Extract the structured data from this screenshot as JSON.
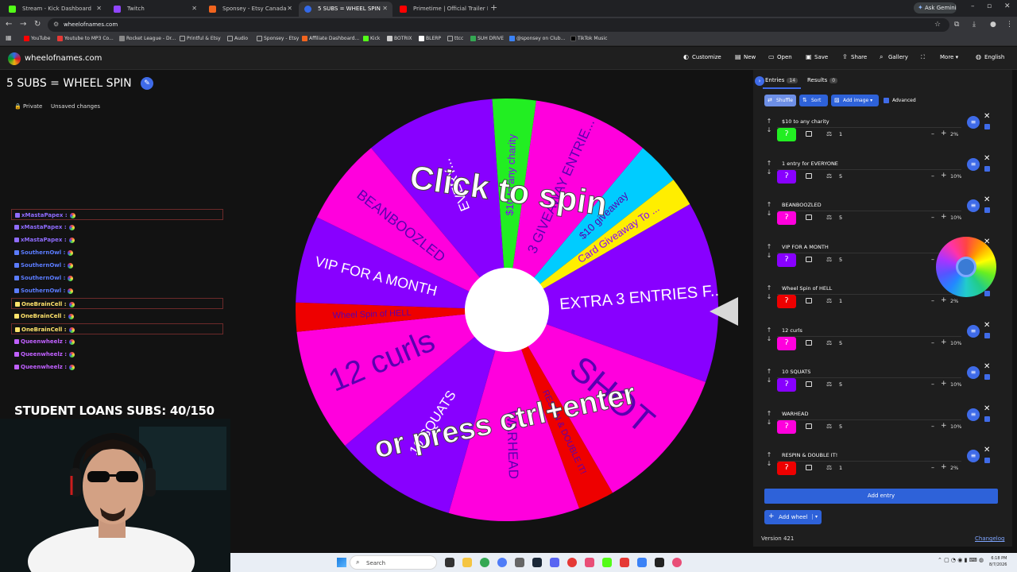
{
  "browser": {
    "tabs": [
      {
        "title": "Stream - Kick Dashboard",
        "color": "#53fc18"
      },
      {
        "title": "Twitch",
        "color": "#9146ff"
      },
      {
        "title": "Sponsey - Etsy Canada",
        "color": "#f1641e"
      },
      {
        "title": "5 SUBS = WHEEL SPIN",
        "color": "#3369e8"
      },
      {
        "title": "Primetime | Official Trailer HD |",
        "color": "#ff0000"
      }
    ],
    "gemini_label": "Ask Gemini",
    "url": "wheelofnames.com",
    "bookmarks": [
      {
        "label": "YouTube",
        "color": "#ff0000"
      },
      {
        "label": "Youtube to MP3 Co...",
        "color": "#e53935"
      },
      {
        "label": "Rocket League - Dr...",
        "color": "#888888"
      },
      {
        "label": "Printful & Etsy",
        "color": "#8a8a8a"
      },
      {
        "label": "Audio",
        "color": "#8a8a8a"
      },
      {
        "label": "Sponsey - Etsy",
        "color": "#8a8a8a"
      },
      {
        "label": "Affiliate Dashboard...",
        "color": "#f1641e"
      },
      {
        "label": "Kick",
        "color": "#53fc18"
      },
      {
        "label": "BOTRIX",
        "color": "#cccccc"
      },
      {
        "label": "BLERP",
        "color": "#ffffff"
      },
      {
        "label": "ttcc",
        "color": "#8a8a8a"
      },
      {
        "label": "SUH DRIVE",
        "color": "#34a853"
      },
      {
        "label": "@sponsey on Club...",
        "color": "#3b82f6"
      },
      {
        "label": "TikTok Music",
        "color": "#000000"
      }
    ]
  },
  "site": {
    "name": "wheelofnames.com",
    "nav": [
      {
        "label": "Customize",
        "icon": "palette-icon"
      },
      {
        "label": "New",
        "icon": "new-file-icon"
      },
      {
        "label": "Open",
        "icon": "folder-icon"
      },
      {
        "label": "Save",
        "icon": "save-icon"
      },
      {
        "label": "Share",
        "icon": "share-icon"
      },
      {
        "label": "Gallery",
        "icon": "search-icon"
      },
      {
        "label": "",
        "icon": "fullscreen-icon"
      },
      {
        "label": "More",
        "icon": "chevron-down-icon"
      },
      {
        "label": "English",
        "icon": "globe-icon"
      }
    ]
  },
  "page": {
    "title": "5 SUBS = WHEEL SPIN",
    "private_label": "Private",
    "unsaved_label": "Unsaved changes"
  },
  "chat": [
    {
      "user": "xMastaPapex :",
      "color": "#8f6cff",
      "boxed": true
    },
    {
      "user": "xMastaPapex :",
      "color": "#8f6cff",
      "boxed": false
    },
    {
      "user": "xMastaPapex :",
      "color": "#8f6cff",
      "boxed": false
    },
    {
      "user": "SouthernOwl :",
      "color": "#5b7cff",
      "boxed": false
    },
    {
      "user": "SouthernOwl :",
      "color": "#5b7cff",
      "boxed": false
    },
    {
      "user": "SouthernOwl :",
      "color": "#5b7cff",
      "boxed": false
    },
    {
      "user": "SouthernOwl :",
      "color": "#5b7cff",
      "boxed": false
    },
    {
      "user": "OneBrainCell :",
      "color": "#ffe36b",
      "boxed": true
    },
    {
      "user": "OneBrainCell :",
      "color": "#ffe36b",
      "boxed": false
    },
    {
      "user": "OneBrainCell :",
      "color": "#ffe36b",
      "boxed": true
    },
    {
      "user": "Queenwheelz :",
      "color": "#c060ff",
      "boxed": false
    },
    {
      "user": "Queenwheelz :",
      "color": "#c060ff",
      "boxed": false
    },
    {
      "user": "Queenwheelz :",
      "color": "#c060ff",
      "boxed": false
    }
  ],
  "overlay": {
    "subgoal": "STUDENT LOANS SUBS: 40/150"
  },
  "wheel": {
    "click_text": "Click to spin",
    "press_text": "or press ctrl+enter",
    "slices": [
      {
        "label": "EVERY...",
        "color": "#8800ff"
      },
      {
        "label": "$10 to any charity",
        "color": "#22ee22"
      },
      {
        "label": "3 GIVEAWAY ENTRIE...",
        "color": "#ff00dd"
      },
      {
        "label": "$10 giveaway",
        "color": "#00ccff"
      },
      {
        "label": "Card Giveaway To ...",
        "color": "#ffee00"
      },
      {
        "label": "EXTRA 3 ENTRIES F...",
        "color": "#8800ff"
      },
      {
        "label": "SHOT",
        "color": "#ff00dd"
      },
      {
        "label": "RESPIN & DOUBLE IT!",
        "color": "#ee0000"
      },
      {
        "label": "WARHEAD",
        "color": "#ff00dd"
      },
      {
        "label": "10 SQUATS",
        "color": "#8800ff"
      },
      {
        "label": "12 curls",
        "color": "#ff00dd"
      },
      {
        "label": "Wheel Spin of HELL",
        "color": "#ee0000"
      },
      {
        "label": "VIP FOR A MONTH",
        "color": "#8800ff"
      },
      {
        "label": "BEANBOOZLED",
        "color": "#ff00dd"
      },
      {
        "label": "1 entry",
        "color": "#8800ff"
      }
    ]
  },
  "panel": {
    "entries_tab": "Entries",
    "entries_count": "14",
    "results_tab": "Results",
    "results_count": "0",
    "buttons": {
      "shuffle": "Shuffle",
      "sort": "Sort",
      "add_image": "Add image",
      "advanced": "Advanced"
    },
    "entries": [
      {
        "text": "$10 to any charity",
        "color": "#22ee22",
        "weight": "1",
        "pct": "2%"
      },
      {
        "text": "1 entry for EVERYONE",
        "color": "#8800ff",
        "weight": "5",
        "pct": "10%"
      },
      {
        "text": "BEANBOOZLED",
        "color": "#ff00dd",
        "weight": "5",
        "pct": "10%"
      },
      {
        "text": "VIP FOR A MONTH",
        "color": "#8800ff",
        "weight": "5",
        "pct": "10%"
      },
      {
        "text": "Wheel Spin of HELL",
        "color": "#ee0000",
        "weight": "1",
        "pct": "2%"
      },
      {
        "text": "12 curls",
        "color": "#ff00dd",
        "weight": "5",
        "pct": "10%"
      },
      {
        "text": "10 SQUATS",
        "color": "#8800ff",
        "weight": "5",
        "pct": "10%"
      },
      {
        "text": "WARHEAD",
        "color": "#ff00dd",
        "weight": "5",
        "pct": "10%"
      },
      {
        "text": "RESPIN & DOUBLE IT!",
        "color": "#ee0000",
        "weight": "1",
        "pct": "2%"
      }
    ],
    "add_entry": "Add entry",
    "add_wheel": "Add wheel",
    "version": "Version 421",
    "changelog": "Changelog"
  },
  "taskbar": {
    "search_placeholder": "Search",
    "time": "6:18 PM",
    "date": "8/7/2026"
  }
}
